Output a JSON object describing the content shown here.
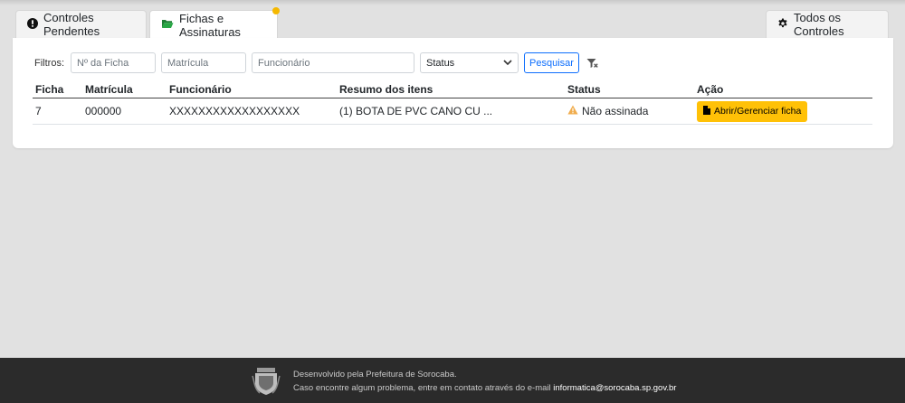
{
  "tabs": [
    {
      "label": "Controles Pendentes",
      "icon": "exclamation-circle-icon"
    },
    {
      "label": "Fichas e Assinaturas",
      "icon": "folder-open-icon",
      "active": true,
      "badge_color": "#f5b800"
    },
    {
      "label": "Todos os Controles",
      "icon": "gear-icon"
    }
  ],
  "filters": {
    "label": "Filtros:",
    "ficha_placeholder": "Nº da Ficha",
    "matricula_placeholder": "Matrícula",
    "funcionario_placeholder": "Funcionário",
    "status_value": "Status",
    "search_label": "Pesquisar",
    "clear_icon": "filter-clear-icon"
  },
  "table": {
    "headers": [
      "Ficha",
      "Matrícula",
      "Funcionário",
      "Resumo dos itens",
      "Status",
      "Ação"
    ],
    "rows": [
      {
        "ficha": "7",
        "matricula": "000000",
        "funcionario": "XXXXXXXXXXXXXXXXXX",
        "resumo": "(1) BOTA DE PVC CANO CU ...",
        "status": "Não assinada",
        "status_icon": "warning-icon",
        "acao": "Abrir/Gerenciar ficha",
        "acao_icon": "file-icon"
      }
    ]
  },
  "footer": {
    "line1": "Desenvolvido pela Prefeitura de Sorocaba.",
    "line2_prefix": "Caso encontre algum problema, entre em contato através do e-mail ",
    "email": "informatica@sorocaba.sp.gov.br"
  },
  "colors": {
    "background": "#e1e1e1",
    "accent_blue": "#0d6efd",
    "action_yellow": "#ffc107",
    "warning": "#f0ad4e",
    "footer_bg": "#2b2b2b"
  }
}
